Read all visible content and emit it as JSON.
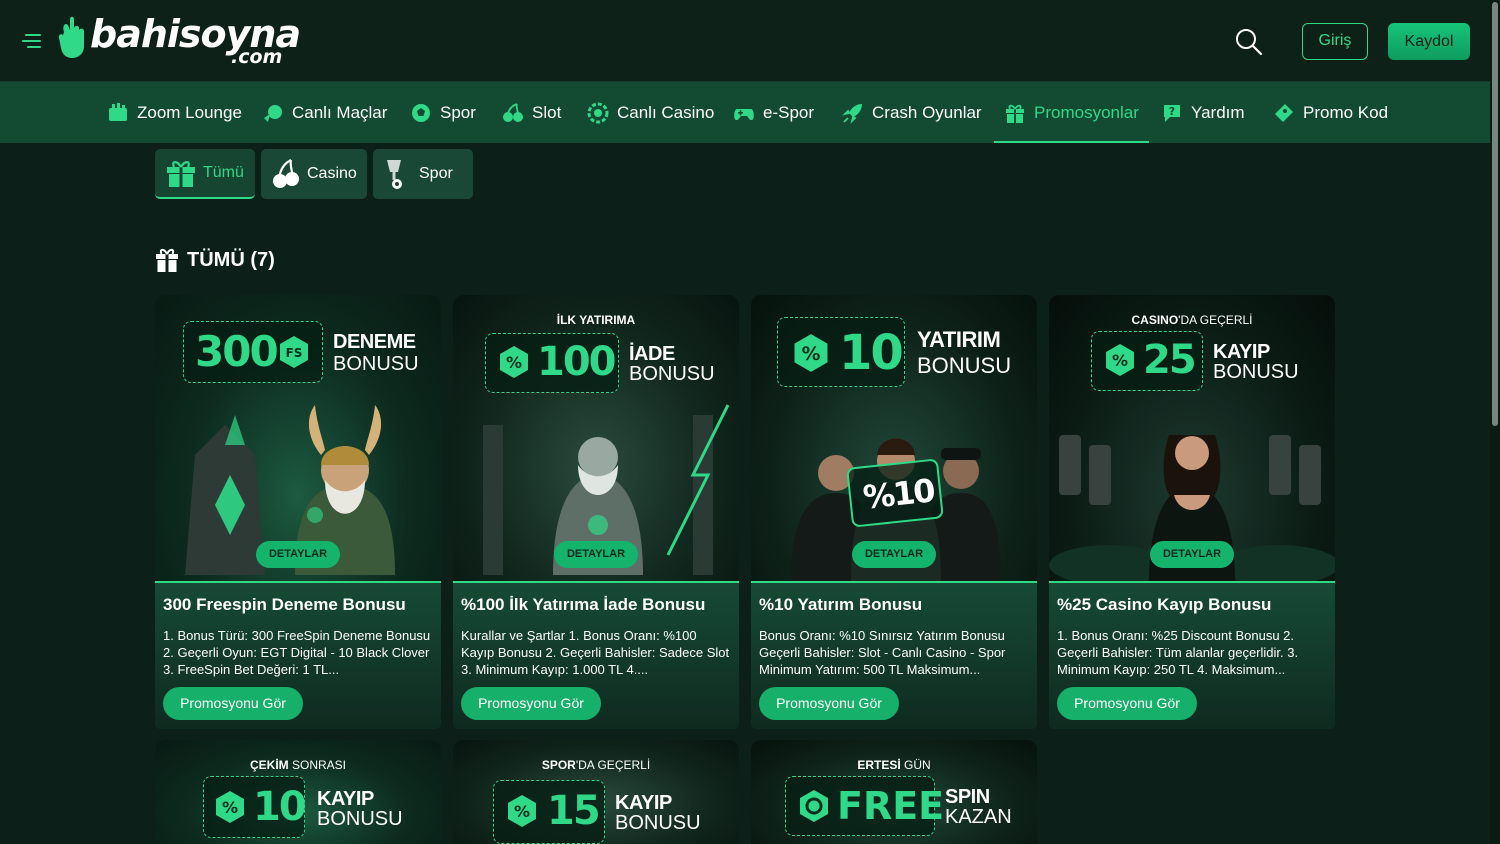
{
  "brand": {
    "name": "bahisoyna",
    "tld": ".com",
    "accent": "#2fd987",
    "bg": "#0c2019",
    "nav_bg": "#124a32"
  },
  "header": {
    "login_label": "Giriş",
    "register_label": "Kaydol"
  },
  "nav": [
    {
      "label": "Zoom Lounge",
      "icon": "zoom-lounge-icon"
    },
    {
      "label": "Canlı Maçlar",
      "icon": "live-matches-icon"
    },
    {
      "label": "Spor",
      "icon": "soccer-ball-icon"
    },
    {
      "label": "Slot",
      "icon": "cherry-icon"
    },
    {
      "label": "Canlı Casino",
      "icon": "casino-chip-icon"
    },
    {
      "label": "e-Spor",
      "icon": "gamepad-icon"
    },
    {
      "label": "Crash Oyunlar",
      "icon": "rocket-icon"
    },
    {
      "label": "Promosyonlar",
      "icon": "gift-icon",
      "active": true
    },
    {
      "label": "Yardım",
      "icon": "help-icon"
    },
    {
      "label": "Promo Kod",
      "icon": "ticket-icon"
    }
  ],
  "filters": [
    {
      "label": "Tümü",
      "icon": "gift-icon",
      "active": true
    },
    {
      "label": "Casino",
      "icon": "cherry-icon"
    },
    {
      "label": "Spor",
      "icon": "trophy-icon"
    }
  ],
  "section": {
    "title": "TÜMÜ (7)"
  },
  "cards": [
    {
      "hero_pre": "",
      "badge_value": "300",
      "badge_suffix": "FS",
      "hero_word1": "DENEME",
      "hero_word2": "BONUSU",
      "detail_label": "DETAYLAR",
      "title": "300 Freespin Deneme Bonusu",
      "desc": "1. Bonus Türü: 300 FreeSpin Deneme Bonusu 2. Geçerli Oyun: EGT Digital - 10 Black Clover 3. FreeSpin Bet Değeri: 1 TL...",
      "button": "Promosyonu Gör"
    },
    {
      "hero_pre_bold": "İLK YATIRIMA",
      "hero_pre_light": "",
      "badge_value": "100",
      "hero_word1": "İADE",
      "hero_word2": "BONUSU",
      "detail_label": "DETAYLAR",
      "title": "%100 İlk Yatırıma İade Bonusu",
      "desc": "Kurallar ve Şartlar 1. Bonus Oranı: %100 Kayıp Bonusu 2. Geçerli Bahisler: Sadece Slot 3. Minimum Kayıp: 1.000 TL 4....",
      "button": "Promosyonu Gör"
    },
    {
      "badge_value": "10",
      "hero_word1": "YATIRIM",
      "hero_word2": "BONUSU",
      "hero_sign": "%10",
      "detail_label": "DETAYLAR",
      "title": "%10 Yatırım Bonusu",
      "desc": "Bonus Oranı: %10 Sınırsız Yatırım Bonusu Geçerli Bahisler: Slot - Canlı Casino - Spor Minimum Yatırım: 500 TL Maksimum...",
      "button": "Promosyonu Gör"
    },
    {
      "hero_pre_bold": "CASINO",
      "hero_pre_light": "'DA GEÇERLİ",
      "badge_value": "25",
      "hero_word1": "KAYIP",
      "hero_word2": "BONUSU",
      "detail_label": "DETAYLAR",
      "title": "%25 Casino Kayıp Bonusu",
      "desc": "1. Bonus Oranı: %25 Discount Bonusu 2. Geçerli Bahisler: Tüm alanlar geçerlidir. 3. Minimum Kayıp: 250 TL 4. Maksimum...",
      "button": "Promosyonu Gör"
    },
    {
      "hero_pre_bold": "ÇEKİM",
      "hero_pre_light": " SONRASI",
      "badge_value": "10",
      "hero_word1": "KAYIP",
      "hero_word2": "BONUSU"
    },
    {
      "hero_pre_bold": "SPOR",
      "hero_pre_light": "'DA GEÇERLİ",
      "badge_value": "15",
      "hero_word1": "KAYIP",
      "hero_word2": "BONUSU"
    },
    {
      "hero_pre_bold": "ERTESİ",
      "hero_pre_light": " GÜN",
      "badge_value": "FREE",
      "hero_word1": "SPIN",
      "hero_word2": "KAZAN"
    }
  ]
}
